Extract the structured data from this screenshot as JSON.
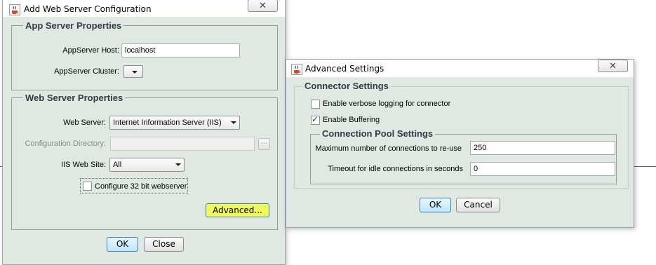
{
  "web_dialog": {
    "title": "Add Web Server Configuration",
    "close_glyph": "✕",
    "app_server": {
      "legend": "App Server Properties",
      "host_label": "AppServer Host:",
      "host_value": "localhost",
      "cluster_label": "AppServer Cluster:",
      "cluster_value": ""
    },
    "web_server": {
      "legend": "Web Server Properties",
      "server_label": "Web Server:",
      "server_value": "Internet Information Server (IIS)",
      "config_dir_label": "Configuration Directory:",
      "config_dir_value": "",
      "browse_label": "...",
      "site_label": "IIS Web Site:",
      "site_value": "All",
      "configure32_label": "Configure 32 bit webserver",
      "configure32_checked": false,
      "advanced_label": "Advanced..."
    },
    "ok_label": "OK",
    "close_label": "Close"
  },
  "adv_dialog": {
    "title": "Advanced Settings",
    "close_glyph": "✕",
    "connector": {
      "legend": "Connector Settings",
      "verbose_label": "Enable verbose logging for connector",
      "verbose_checked": false,
      "buffering_label": "Enable Buffering",
      "buffering_checked": true
    },
    "pool": {
      "legend": "Connection Pool Settings",
      "max_label": "Maximum number of connections to re-use",
      "max_value": "250",
      "timeout_label": "Timeout for idle connections in seconds",
      "timeout_value": "0"
    },
    "ok_label": "OK",
    "cancel_label": "Cancel"
  },
  "colors": {
    "dialog_bg": "#dfe8e1",
    "highlight": "#f1f95a",
    "focus_border": "#3c7fb1"
  },
  "icons": {
    "app_icon": "java-cup-icon",
    "close_icon": "close-x-icon",
    "checkbox_mark": "✓"
  }
}
